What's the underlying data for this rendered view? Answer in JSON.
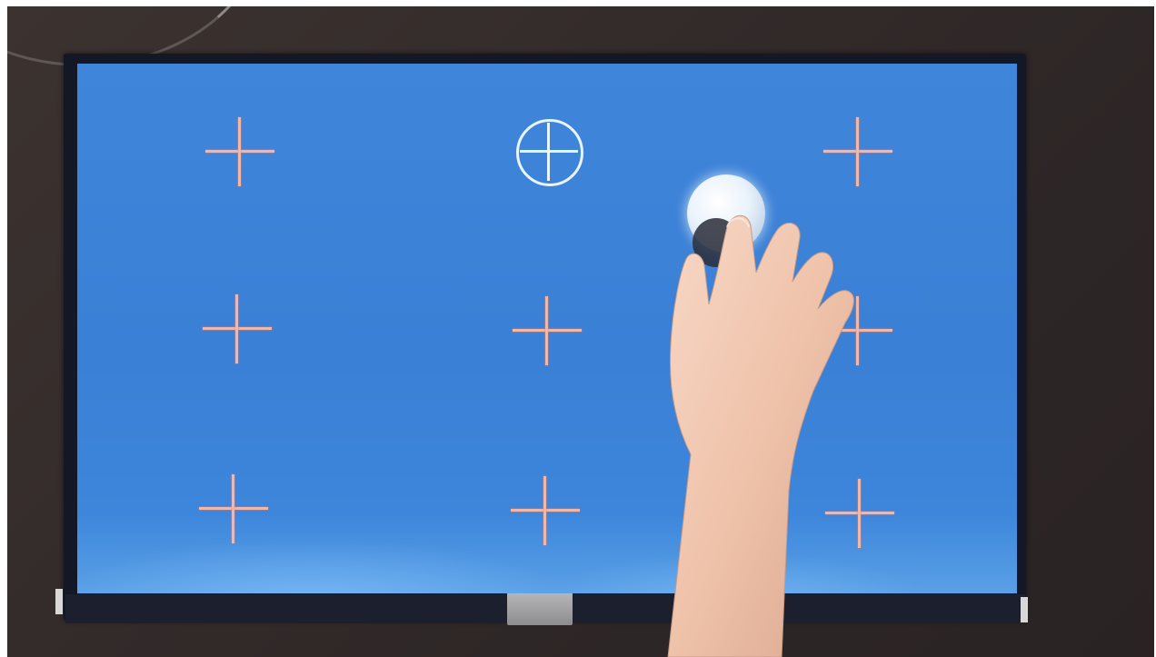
{
  "scene": {
    "description_label": "",
    "background_color": "#2d2626",
    "screen_color": "#3b82d8",
    "target_color": "#f2b7a6",
    "active_target_color": "#e8f4ff",
    "skin_color": "#f3c9b3"
  },
  "calibration": {
    "grid_rows": 3,
    "grid_cols": 3,
    "active_target": {
      "row": 0,
      "col": 1
    },
    "targets": [
      {
        "row": 0,
        "col": 0,
        "icon": "crosshair-icon"
      },
      {
        "row": 0,
        "col": 1,
        "icon": "crosshair-circle-icon",
        "active": true
      },
      {
        "row": 0,
        "col": 2,
        "icon": "crosshair-icon"
      },
      {
        "row": 1,
        "col": 0,
        "icon": "crosshair-icon"
      },
      {
        "row": 1,
        "col": 1,
        "icon": "crosshair-icon"
      },
      {
        "row": 1,
        "col": 2,
        "icon": "crosshair-icon"
      },
      {
        "row": 2,
        "col": 0,
        "icon": "crosshair-icon"
      },
      {
        "row": 2,
        "col": 1,
        "icon": "crosshair-icon"
      },
      {
        "row": 2,
        "col": 2,
        "icon": "crosshair-icon"
      }
    ]
  }
}
